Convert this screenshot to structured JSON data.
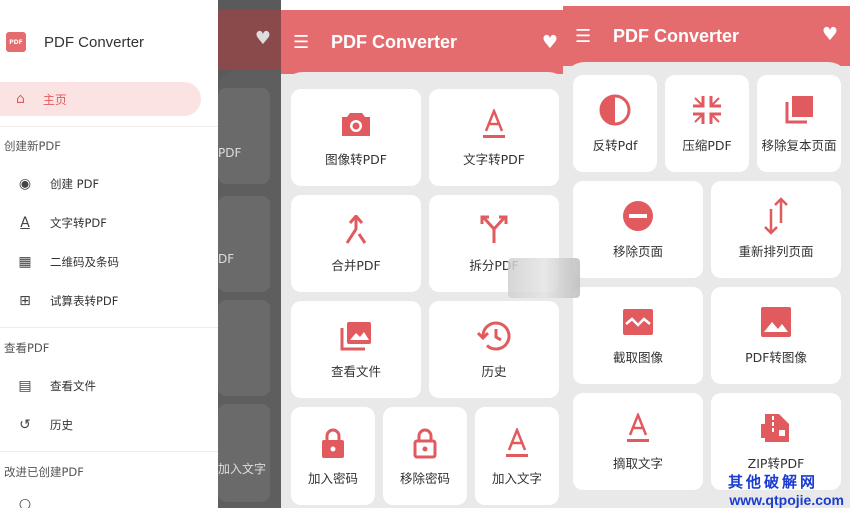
{
  "drawer": {
    "logo": "PDF",
    "title": "PDF Converter",
    "home": "主页",
    "sections": [
      {
        "title": "创建新PDF",
        "items": [
          {
            "icon": "camera-icon",
            "label": "创建 PDF"
          },
          {
            "icon": "text-icon",
            "label": "文字转PDF"
          },
          {
            "icon": "qrcode-icon",
            "label": "二维码及条码"
          },
          {
            "icon": "table-icon",
            "label": "试算表转PDF"
          }
        ]
      },
      {
        "title": "查看PDF",
        "items": [
          {
            "icon": "image-icon",
            "label": "查看文件"
          },
          {
            "icon": "history-icon",
            "label": "历史"
          }
        ]
      },
      {
        "title": "改进已创建PDF",
        "items": []
      }
    ]
  },
  "background_panel": {
    "card_labels": [
      "PDF",
      "DF",
      "加入文字"
    ]
  },
  "panel2": {
    "title": "PDF Converter",
    "cards": [
      {
        "icon": "camera-icon",
        "label": "图像转PDF"
      },
      {
        "icon": "text-icon",
        "label": "文字转PDF"
      },
      {
        "icon": "merge-icon",
        "label": "合并PDF"
      },
      {
        "icon": "split-icon",
        "label": "拆分PDF"
      },
      {
        "icon": "image-icon",
        "label": "查看文件"
      },
      {
        "icon": "history-icon",
        "label": "历史"
      },
      {
        "icon": "lock-icon",
        "label": "加入密码"
      },
      {
        "icon": "unlock-icon",
        "label": "移除密码"
      },
      {
        "icon": "text-icon",
        "label": "加入文字"
      }
    ]
  },
  "panel3": {
    "title": "PDF Converter",
    "cards": [
      {
        "icon": "invert-icon",
        "label": "反转Pdf"
      },
      {
        "icon": "compress-icon",
        "label": "压缩PDF"
      },
      {
        "icon": "duplicate-icon",
        "label": "移除复本页面"
      },
      {
        "icon": "remove-page-icon",
        "label": "移除页面"
      },
      {
        "icon": "reorder-icon",
        "label": "重新排列页面"
      },
      {
        "icon": "crop-image-icon",
        "label": "截取图像"
      },
      {
        "icon": "pdf-to-image-icon",
        "label": "PDF转图像"
      },
      {
        "icon": "extract-text-icon",
        "label": "摘取文字"
      },
      {
        "icon": "zip-icon",
        "label": "ZIP转PDF"
      }
    ]
  },
  "watermark": {
    "line1": "其他破解网",
    "line2": "www.qtpojie.com"
  },
  "colors": {
    "accent": "#e46b6e",
    "icon": "#e05a5e",
    "background": "#e9e9e9"
  }
}
